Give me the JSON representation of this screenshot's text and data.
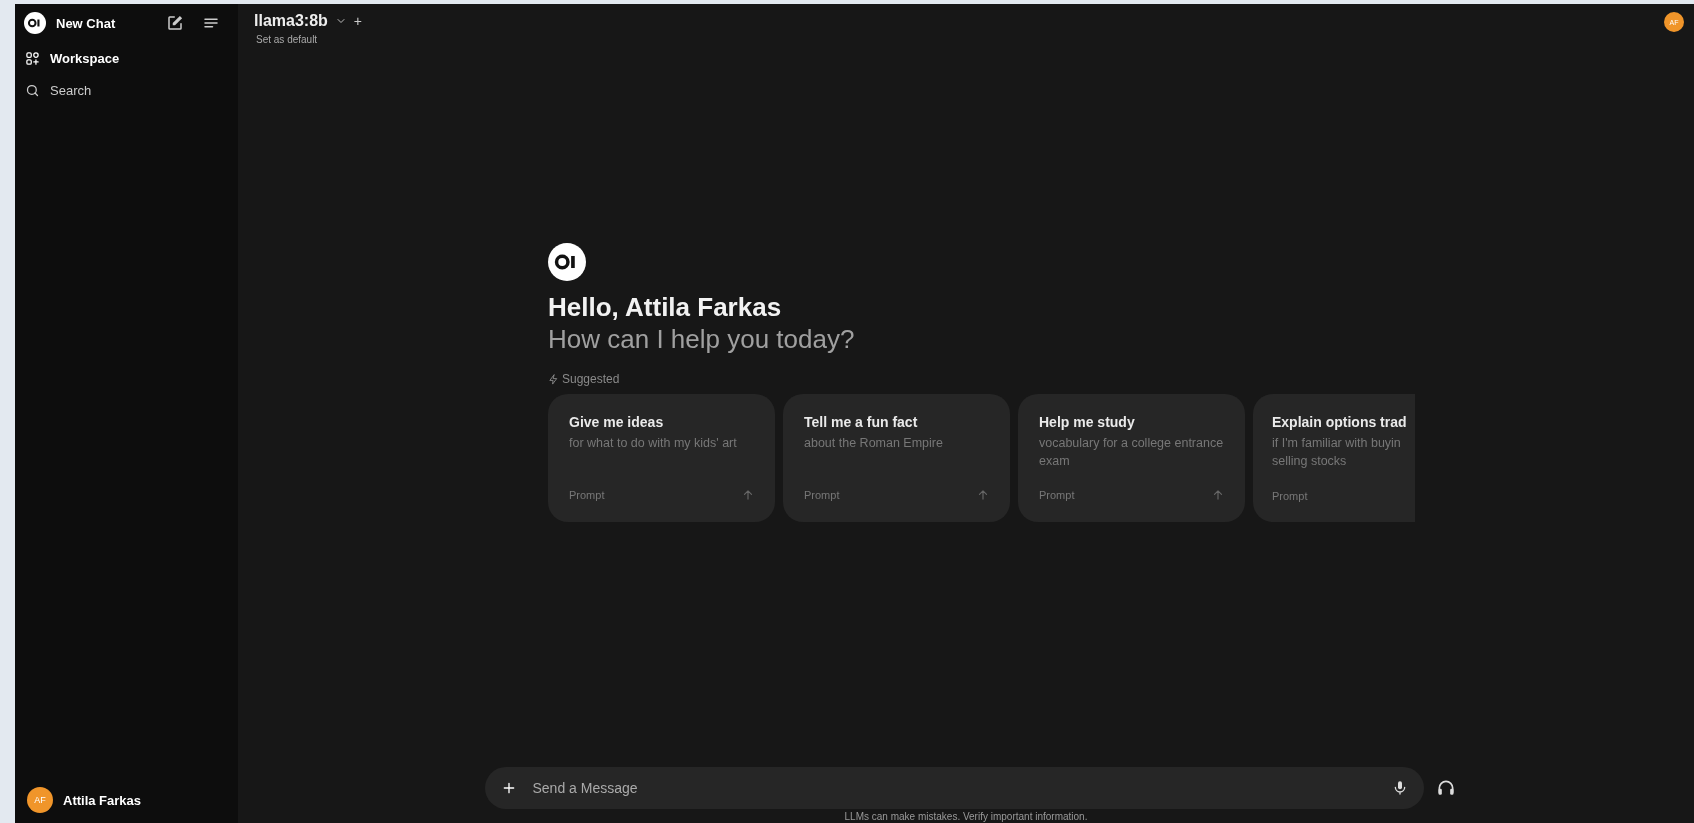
{
  "sidebar": {
    "app_name": "New Chat",
    "items": [
      {
        "kind": "workspace",
        "label": "Workspace"
      },
      {
        "kind": "search",
        "label": "Search"
      }
    ],
    "user": {
      "initials": "AF",
      "name": "Attila Farkas"
    }
  },
  "header": {
    "model": "llama3:8b",
    "set_default": "Set as default",
    "add": "+",
    "avatar": "AF"
  },
  "greeting": {
    "title": "Hello, Attila Farkas",
    "subtitle": "How can I help you today?"
  },
  "suggested_label": "Suggested",
  "suggestions": [
    {
      "title": "Give me ideas",
      "subtitle": "for what to do with my kids' art",
      "tag": "Prompt",
      "clipped": false
    },
    {
      "title": "Tell me a fun fact",
      "subtitle": "about the Roman Empire",
      "tag": "Prompt",
      "clipped": false
    },
    {
      "title": "Help me study",
      "subtitle": "vocabulary for a college entrance exam",
      "tag": "Prompt",
      "clipped": false
    },
    {
      "title": "Explain options trad",
      "subtitle": "if I'm familiar with buyin selling stocks",
      "tag": "Prompt",
      "clipped": true
    }
  ],
  "composer": {
    "placeholder": "Send a Message"
  },
  "disclaimer": "LLMs can make mistakes. Verify important information."
}
